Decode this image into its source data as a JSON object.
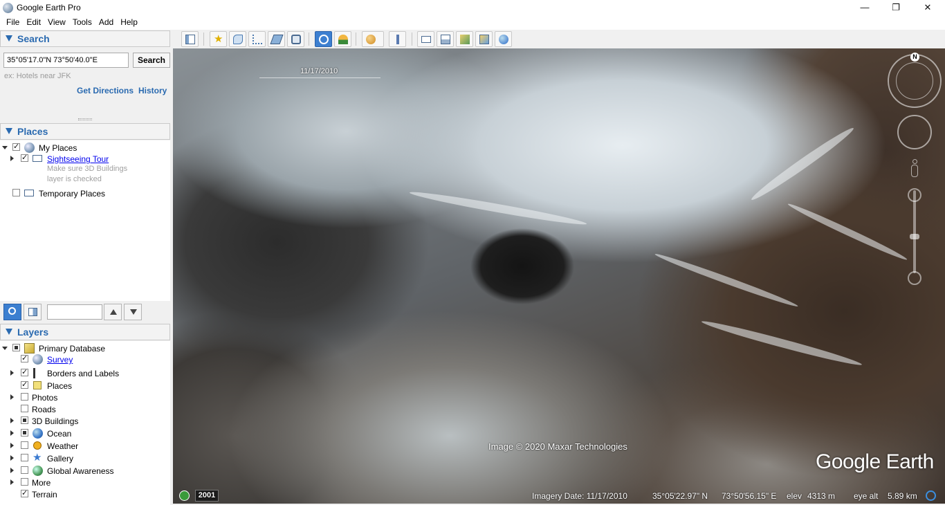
{
  "window": {
    "title": "Google Earth Pro",
    "minimize": "—",
    "maximize": "❐",
    "close": "✕"
  },
  "menu": [
    "File",
    "Edit",
    "View",
    "Tools",
    "Add",
    "Help"
  ],
  "search": {
    "header": "Search",
    "value": "35°05'17.0\"N 73°50'40.0\"E",
    "button": "Search",
    "hint": "ex: Hotels near JFK",
    "get_directions": "Get Directions",
    "history": "History"
  },
  "places": {
    "header": "Places",
    "my_places": "My Places",
    "sightseeing": "Sightseeing Tour",
    "note_line1": "Make sure 3D Buildings",
    "note_line2": "layer is checked",
    "temporary": "Temporary Places"
  },
  "layers": {
    "header": "Layers",
    "items": [
      "Primary Database",
      "Survey",
      "Borders and Labels",
      "Places",
      "Photos",
      "Roads",
      "3D Buildings",
      "Ocean",
      "Weather",
      "Gallery",
      "Global Awareness",
      "More",
      "Terrain"
    ]
  },
  "map": {
    "date_scale": "11/17/2010",
    "copyright": "Image © 2020 Maxar Technologies",
    "logo": "Google Earth",
    "compass_north": "N",
    "year": "2001",
    "imagery_date": "Imagery Date: 11/17/2010",
    "lat": "35°05'22.97\" N",
    "lon": "73°50'56.15\" E",
    "elev_label": "elev",
    "elev": "4313 m",
    "eye_alt_label": "eye alt",
    "eye_alt": "5.89 km"
  },
  "colors": {
    "accent": "#2a6ab0",
    "link": "#0000ee",
    "active_tool": "#3c7fd0"
  },
  "toolbar_icons": [
    "sidebar-icon",
    "placemark-icon",
    "polygon-icon",
    "path-icon",
    "overlay-icon",
    "record-tour-icon",
    "historical-imagery-icon",
    "sunlight-icon",
    "planets-icon",
    "ruler-icon",
    "email-icon",
    "print-icon",
    "google-maps-icon",
    "save-image-icon",
    "earth-icon"
  ]
}
